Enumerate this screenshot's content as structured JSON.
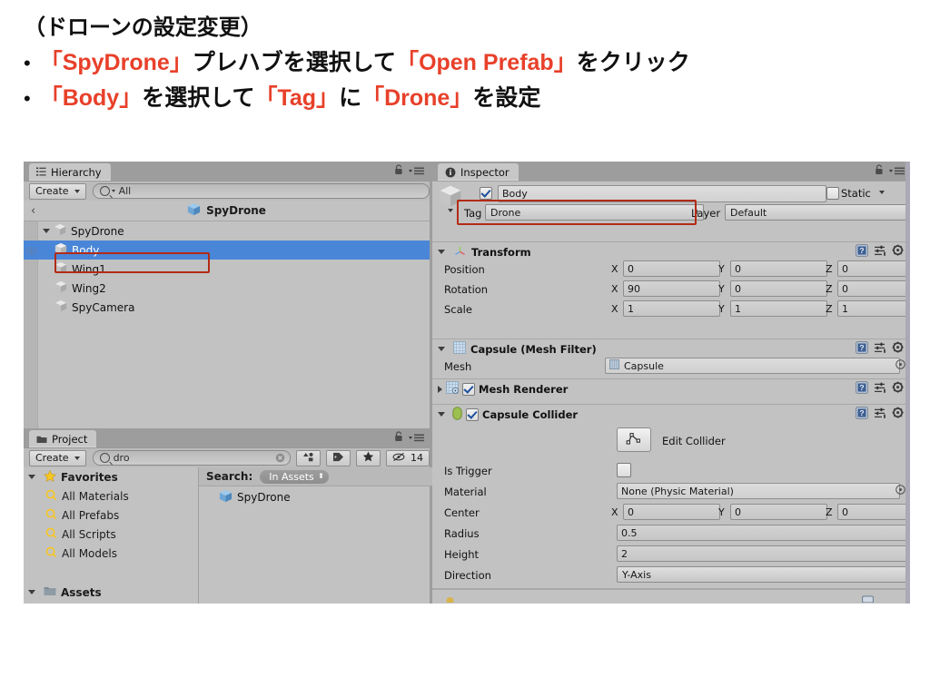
{
  "slide": {
    "heading": "（ドローンの設定変更）",
    "bullets": [
      {
        "dot": "•",
        "parts": [
          {
            "t": "「SpyDrone」",
            "c": "red"
          },
          {
            "t": "プレハブを選択して",
            "c": "blk"
          },
          {
            "t": "「Open Prefab」",
            "c": "red"
          },
          {
            "t": "をクリック",
            "c": "blk"
          }
        ]
      },
      {
        "dot": "•",
        "parts": [
          {
            "t": "「Body」",
            "c": "red"
          },
          {
            "t": "を選択して",
            "c": "blk"
          },
          {
            "t": "「Tag」",
            "c": "red"
          },
          {
            "t": "に",
            "c": "blk"
          },
          {
            "t": "「Drone」",
            "c": "red"
          },
          {
            "t": "を設定",
            "c": "blk"
          }
        ]
      }
    ]
  },
  "hierarchy": {
    "tab_label": "Hierarchy",
    "create_label": "Create",
    "search_placeholder": "All",
    "breadcrumb_name": "SpyDrone",
    "tree": [
      {
        "label": "SpyDrone",
        "depth": 0,
        "expanded": true,
        "selected": false
      },
      {
        "label": "Body",
        "depth": 1,
        "expanded": false,
        "selected": true
      },
      {
        "label": "Wing1",
        "depth": 1,
        "expanded": false,
        "selected": false
      },
      {
        "label": "Wing2",
        "depth": 1,
        "expanded": false,
        "selected": false
      },
      {
        "label": "SpyCamera",
        "depth": 1,
        "expanded": false,
        "selected": false
      }
    ]
  },
  "project": {
    "tab_label": "Project",
    "create_label": "Create",
    "search_value": "dro",
    "hidden_count": "14",
    "favorites_label": "Favorites",
    "favorites": [
      {
        "label": "All Materials"
      },
      {
        "label": "All Prefabs"
      },
      {
        "label": "All Scripts"
      },
      {
        "label": "All Models"
      }
    ],
    "assets_label": "Assets",
    "search_row_label": "Search:",
    "search_scope": "In Assets",
    "results": [
      {
        "label": "SpyDrone"
      }
    ]
  },
  "inspector": {
    "tab_label": "Inspector",
    "object_name": "Body",
    "object_enabled": true,
    "static_label": "Static",
    "static_checked": false,
    "tag_label": "Tag",
    "tag_value": "Drone",
    "layer_label": "Layer",
    "layer_value": "Default",
    "components": [
      {
        "title": "Transform",
        "expanded": true,
        "rows": [
          {
            "label": "Position",
            "x": "0",
            "y": "0",
            "z": "0"
          },
          {
            "label": "Rotation",
            "x": "90",
            "y": "0",
            "z": "0"
          },
          {
            "label": "Scale",
            "x": "1",
            "y": "1",
            "z": "1"
          }
        ]
      },
      {
        "title": "Capsule (Mesh Filter)",
        "expanded": true,
        "mesh_label": "Mesh",
        "mesh_value": "Capsule"
      },
      {
        "title": "Mesh Renderer",
        "expanded": false,
        "enabled": true
      },
      {
        "title": "Capsule Collider",
        "expanded": true,
        "enabled": true,
        "edit_collider_label": "Edit Collider",
        "is_trigger_label": "Is Trigger",
        "is_trigger_checked": false,
        "material_label": "Material",
        "material_value": "None (Physic Material)",
        "center_label": "Center",
        "center": {
          "x": "0",
          "y": "0",
          "z": "0"
        },
        "radius_label": "Radius",
        "radius_value": "0.5",
        "height_label": "Height",
        "height_value": "2",
        "direction_label": "Direction",
        "direction_value": "Y-Axis"
      }
    ]
  },
  "colors": {
    "accent_red": "#e8402a",
    "highlight_box": "#b32a14",
    "selection_blue": "#4a86d8",
    "panel_gray": "#c2c2c2"
  }
}
